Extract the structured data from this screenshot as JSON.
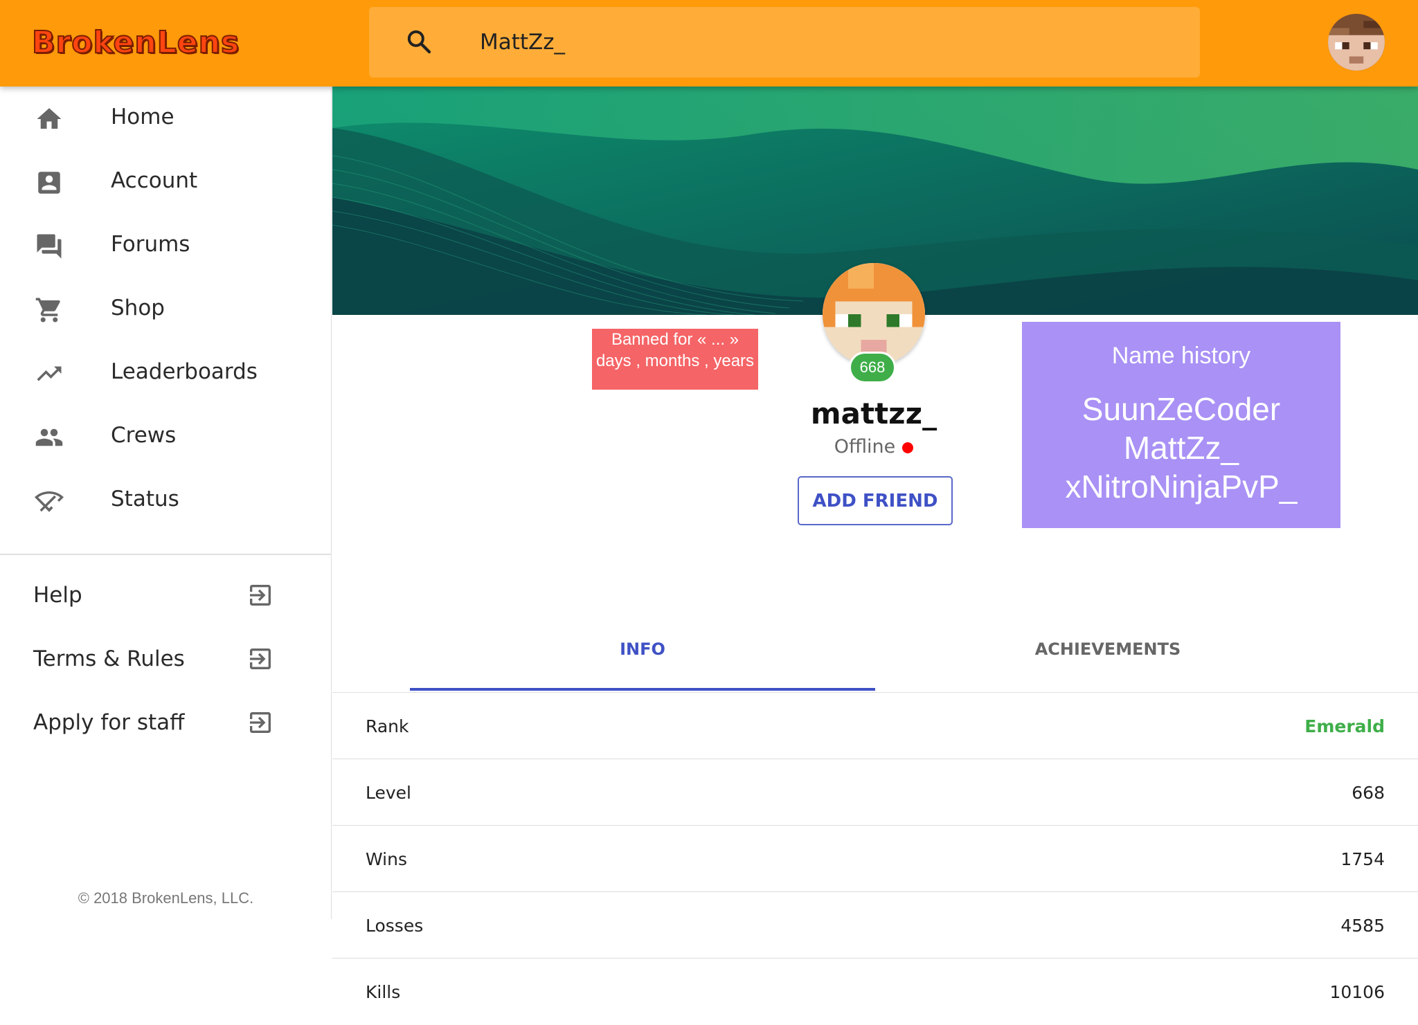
{
  "header": {
    "logo": "BrokenLens",
    "search_value": "MattZz_",
    "colors": {
      "bar": "#ff9a0a",
      "search": "#ffad38",
      "logo": "#ff4510"
    }
  },
  "sidebar": {
    "items": [
      {
        "label": "Home",
        "icon": "home-icon"
      },
      {
        "label": "Account",
        "icon": "account-box-icon"
      },
      {
        "label": "Forums",
        "icon": "forum-icon"
      },
      {
        "label": "Shop",
        "icon": "cart-icon"
      },
      {
        "label": "Leaderboards",
        "icon": "trending-up-icon"
      },
      {
        "label": "Crews",
        "icon": "people-icon"
      },
      {
        "label": "Status",
        "icon": "wifi-off-icon"
      }
    ],
    "links": [
      {
        "label": "Help",
        "icon": "external-link-icon"
      },
      {
        "label": "Terms & Rules",
        "icon": "external-link-icon"
      },
      {
        "label": "Apply for staff",
        "icon": "external-link-icon"
      }
    ],
    "copyright": "© 2018 BrokenLens, LLC."
  },
  "profile": {
    "ban_text": "Banned for « ... » days , months , years",
    "level_badge": "668",
    "username": "mattzz_",
    "status": "Offline",
    "add_friend": "ADD FRIEND",
    "name_history": {
      "title": "Name history",
      "names": [
        "SuunZeCoder",
        "MattZz_",
        "xNitroNinjaPvP_"
      ]
    }
  },
  "tabs": [
    "INFO",
    "ACHIEVEMENTS"
  ],
  "stats": [
    {
      "name": "Rank",
      "value": "Emerald"
    },
    {
      "name": "Level",
      "value": "668"
    },
    {
      "name": "Wins",
      "value": "1754"
    },
    {
      "name": "Losses",
      "value": "4585"
    },
    {
      "name": "Kills",
      "value": "10106"
    }
  ]
}
